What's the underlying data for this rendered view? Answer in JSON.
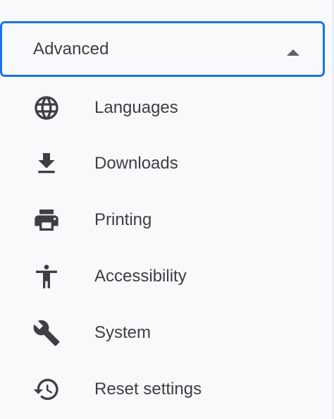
{
  "advanced": {
    "label": "Advanced",
    "expanded": true,
    "caret_icon": "arrow-drop-up-icon",
    "focus_color": "#1a73e8"
  },
  "items": [
    {
      "label": "Languages",
      "icon": "globe-icon"
    },
    {
      "label": "Downloads",
      "icon": "download-icon"
    },
    {
      "label": "Printing",
      "icon": "printer-icon"
    },
    {
      "label": "Accessibility",
      "icon": "accessibility-icon"
    },
    {
      "label": "System",
      "icon": "wrench-icon"
    },
    {
      "label": "Reset settings",
      "icon": "restore-icon"
    }
  ],
  "colors": {
    "background": "#f8f9fa",
    "text": "#3c4043",
    "icon": "#3c4043"
  }
}
